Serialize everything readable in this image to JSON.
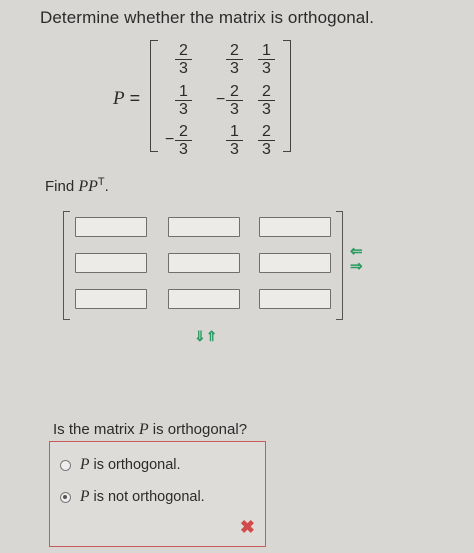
{
  "question": "Determine whether the matrix is orthogonal.",
  "matrix_label": "P",
  "matrix_equals": "=",
  "matrix_rows": [
    [
      {
        "sign": "",
        "num": "2",
        "den": "3"
      },
      {
        "sign": "",
        "num": "2",
        "den": "3"
      },
      {
        "sign": "",
        "num": "1",
        "den": "3"
      }
    ],
    [
      {
        "sign": "",
        "num": "1",
        "den": "3"
      },
      {
        "sign": "−",
        "num": "2",
        "den": "3"
      },
      {
        "sign": "",
        "num": "2",
        "den": "3"
      }
    ],
    [
      {
        "sign": "−",
        "num": "2",
        "den": "3"
      },
      {
        "sign": "",
        "num": "1",
        "den": "3"
      },
      {
        "sign": "",
        "num": "2",
        "den": "3"
      }
    ]
  ],
  "find_prefix": "Find ",
  "find_expr": "PP",
  "find_sup": "T",
  "find_suffix": ".",
  "answer_grid": [
    [
      "",
      "",
      ""
    ],
    [
      "",
      "",
      ""
    ],
    [
      "",
      "",
      ""
    ]
  ],
  "row_arrows": "⇐⇒",
  "col_arrows": "⇓⇑",
  "orthogonal_question_prefix": "Is the matrix ",
  "orthogonal_question_var": "P",
  "orthogonal_question_suffix": " is orthogonal?",
  "options": [
    {
      "var": "P",
      "text": "is orthogonal.",
      "selected": false
    },
    {
      "var": "P",
      "text": "is not orthogonal.",
      "selected": true
    }
  ],
  "feedback_icon": "✖",
  "colors": {
    "error": "#d24b4b",
    "arrows": "#2d9b61"
  }
}
